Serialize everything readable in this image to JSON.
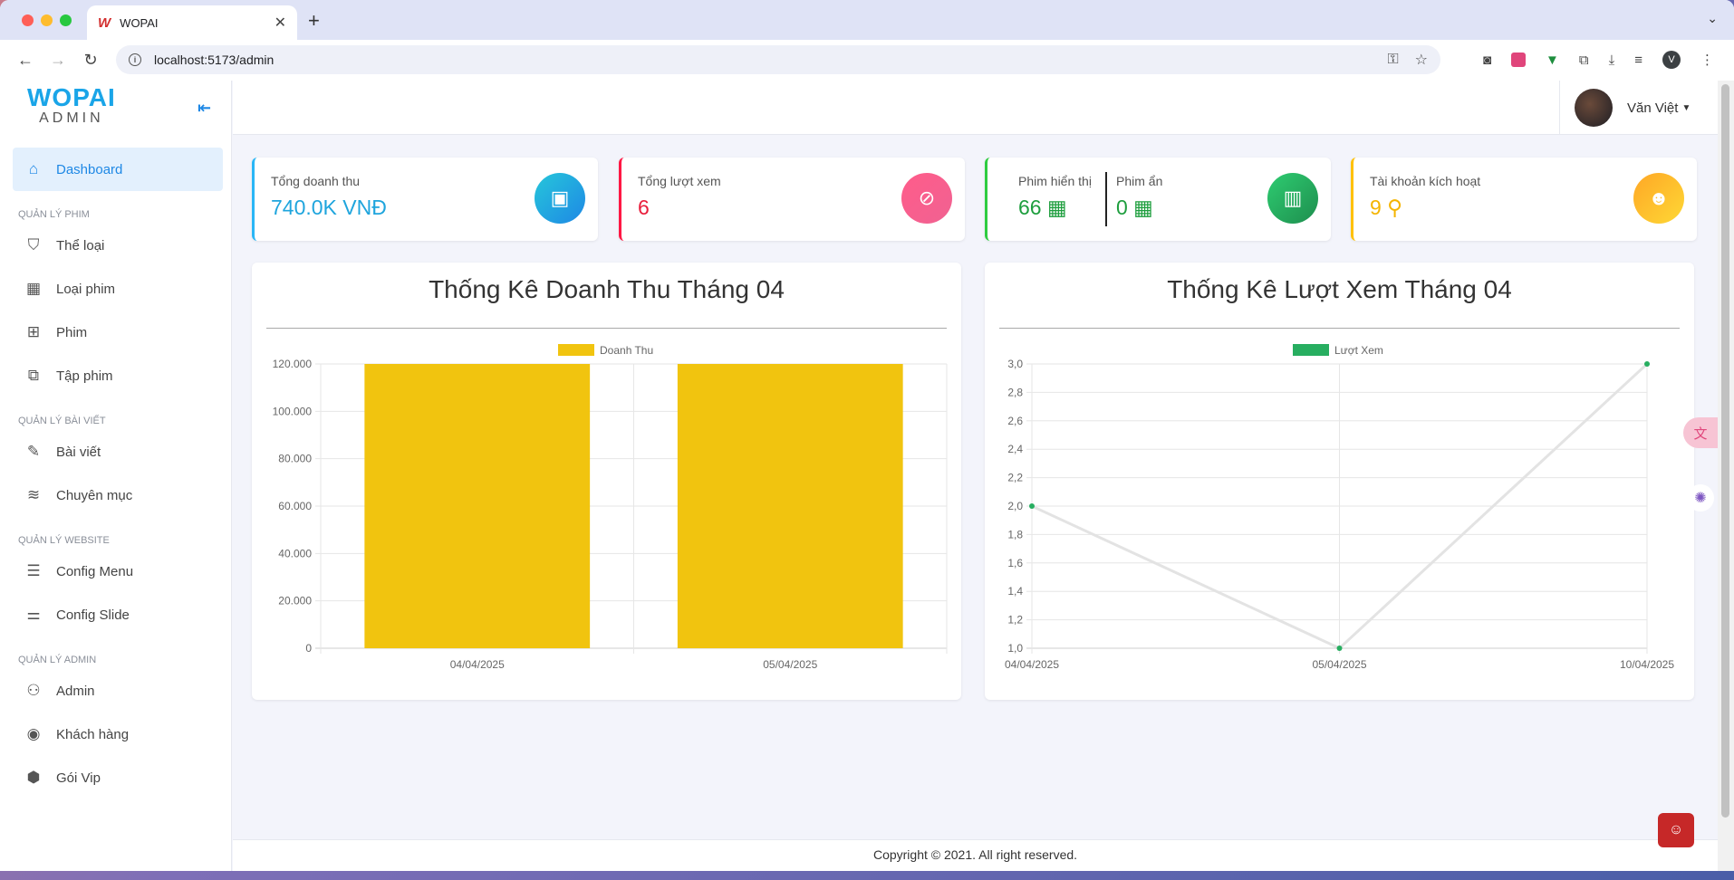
{
  "browser": {
    "tab_title": "WOPAI",
    "tab_favicon": "W",
    "url": "localhost:5173/admin",
    "profile_initial": "V"
  },
  "brand": {
    "name": "WOPAI",
    "sub": "ADMIN"
  },
  "sidebar": {
    "dashboard": "Dashboard",
    "sections": [
      {
        "title": "QUẢN LÝ PHIM",
        "items": [
          "Thể loại",
          "Loại phim",
          "Phim",
          "Tập phim"
        ]
      },
      {
        "title": "QUẢN LÝ BÀI VIẾT",
        "items": [
          "Bài viết",
          "Chuyên mục"
        ]
      },
      {
        "title": "QUẢN LÝ WEBSITE",
        "items": [
          "Config Menu",
          "Config Slide"
        ]
      },
      {
        "title": "QUẢN LÝ ADMIN",
        "items": [
          "Admin",
          "Khách hàng",
          "Gói Vip"
        ]
      }
    ]
  },
  "header": {
    "user_name": "Văn Việt"
  },
  "stats": {
    "revenue": {
      "label": "Tổng doanh thu",
      "value": "740.0K VNĐ"
    },
    "views": {
      "label": "Tổng lượt xem",
      "value": "6"
    },
    "movies": {
      "shown_label": "Phim hiển thị",
      "shown_value": "66",
      "hidden_label": "Phim ẩn",
      "hidden_value": "0"
    },
    "accounts": {
      "label": "Tài khoản kích hoạt",
      "value": "9"
    }
  },
  "charts": {
    "revenue_title": "Thống Kê Doanh Thu Tháng 04",
    "views_title": "Thống Kê Lượt Xem Tháng 04"
  },
  "chart_data": [
    {
      "type": "bar",
      "title": "Thống Kê Doanh Thu Tháng 04",
      "categories": [
        "04/04/2025",
        "05/04/2025"
      ],
      "series": [
        {
          "name": "Doanh Thu",
          "values": [
            120000,
            120000
          ],
          "color": "#f1c40f"
        }
      ],
      "ylim": [
        0,
        120000
      ],
      "yticks": [
        "0",
        "20.000",
        "40.000",
        "60.000",
        "80.000",
        "100.000",
        "120.000"
      ],
      "legend": "top",
      "grid": true
    },
    {
      "type": "line",
      "title": "Thống Kê Lượt Xem Tháng 04",
      "categories": [
        "04/04/2025",
        "05/04/2025",
        "10/04/2025"
      ],
      "series": [
        {
          "name": "Lượt Xem",
          "values": [
            2,
            1,
            3
          ],
          "color": "#27ae60"
        }
      ],
      "ylim": [
        1,
        3
      ],
      "yticks": [
        "1,0",
        "1,2",
        "1,4",
        "1,6",
        "1,8",
        "2,0",
        "2,2",
        "2,4",
        "2,6",
        "2,8",
        "3,0"
      ],
      "legend": "top",
      "grid": true
    }
  ],
  "footer": {
    "text": "Copyright © 2021. All right reserved."
  }
}
